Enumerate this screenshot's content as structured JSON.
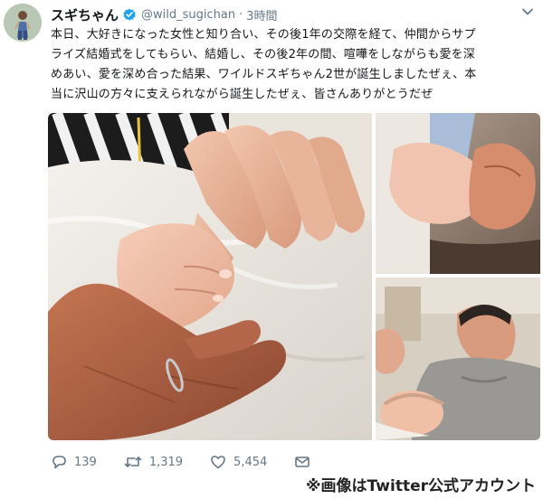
{
  "tweet": {
    "display_name": "スギちゃん",
    "handle": "@wild_sugichan",
    "separator": "·",
    "time": "3時間",
    "text_lines": [
      "本日、大好きになった女性と知り合い、その後1年の交際を経て、仲間からサプ",
      "ライズ結婚式をしてもらい、結婚し、その後2年の間、喧嘩をしながらも愛を深",
      "めあい、愛を深め合った結果、ワイルドスギちゃん2世が誕生しましたぜぇ、本",
      "当に沢山の方々に支えられながら誕生したぜぇ、皆さんありがとうだぜ"
    ]
  },
  "actions": {
    "replies": "139",
    "retweets": "1,319",
    "likes": "5,454"
  },
  "credit": "※画像はTwitter公式アカウント",
  "icons": {
    "verified": "verified-badge-icon",
    "reply": "reply-icon",
    "retweet": "retweet-icon",
    "like": "heart-icon",
    "dm": "envelope-icon",
    "menu": "chevron-down-icon"
  },
  "colors": {
    "verified": "#1da1f2",
    "muted": "#657786",
    "text": "#14171a"
  }
}
